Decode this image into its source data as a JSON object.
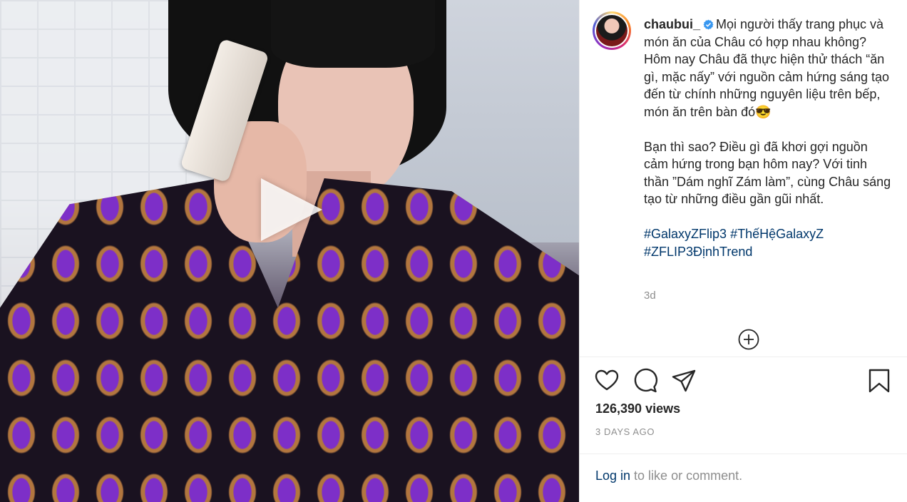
{
  "post": {
    "username": "chaubui_",
    "caption_p1": "Mọi người thấy trang phục và món ăn của Châu có hợp nhau không? Hôm nay Châu đã thực hiện thử thách “ăn gì, mặc nấy” với nguồn cảm hứng sáng tạo đến từ chính những nguyên liệu trên bếp, món ăn trên bàn đó😎",
    "caption_p2": "Bạn thì sao? Điều gì đã khơi gợi nguồn cảm hứng trong bạn hôm nay? Với tinh thần ”Dám nghĩ Zám làm”, cùng Châu sáng tạo từ những điều gần gũi nhất.",
    "hashtags": [
      "#GalaxyZFlip3",
      "#ThếHệGalaxyZ",
      "#ZFLIP3ĐịnhTrend"
    ],
    "time_short": "3d",
    "views": "126,390 views",
    "time_ago": "3 DAYS AGO",
    "login_link": "Log in",
    "login_suffix": " to like or comment."
  },
  "colors": {
    "link": "#00376b",
    "muted": "#8e8e8e",
    "verified": "#3897f0"
  },
  "icons": [
    "play-icon",
    "verified-badge-icon",
    "plus-circle-icon",
    "heart-icon",
    "comment-icon",
    "share-icon",
    "bookmark-icon"
  ]
}
